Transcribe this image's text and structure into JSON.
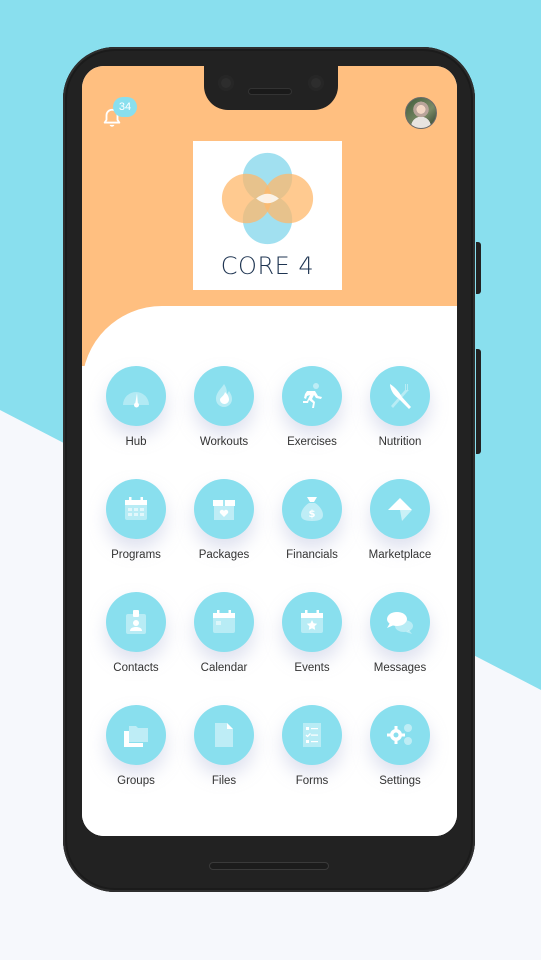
{
  "colors": {
    "background_blue": "#89dfee",
    "background_light": "#f6f8fc",
    "header_orange": "#ffbf80",
    "icon_circle": "#89dfee",
    "phone_body": "#222222",
    "logo_text": "#1f3552"
  },
  "header": {
    "notification_icon": "bell-icon",
    "notification_count": "34",
    "avatar_icon": "user-avatar"
  },
  "logo": {
    "text": "CORE 4"
  },
  "menu": [
    {
      "label": "Hub",
      "icon": "speedometer-icon"
    },
    {
      "label": "Workouts",
      "icon": "flame-icon"
    },
    {
      "label": "Exercises",
      "icon": "running-person-icon"
    },
    {
      "label": "Nutrition",
      "icon": "fork-knife-icon"
    },
    {
      "label": "Programs",
      "icon": "calendar-grid-icon"
    },
    {
      "label": "Packages",
      "icon": "gift-box-heart-icon"
    },
    {
      "label": "Financials",
      "icon": "money-bag-icon"
    },
    {
      "label": "Marketplace",
      "icon": "marketplace-arrow-icon"
    },
    {
      "label": "Contacts",
      "icon": "id-badge-icon"
    },
    {
      "label": "Calendar",
      "icon": "calendar-icon"
    },
    {
      "label": "Events",
      "icon": "calendar-star-icon"
    },
    {
      "label": "Messages",
      "icon": "chat-bubbles-icon"
    },
    {
      "label": "Groups",
      "icon": "folders-icon"
    },
    {
      "label": "Files",
      "icon": "file-icon"
    },
    {
      "label": "Forms",
      "icon": "checklist-icon"
    },
    {
      "label": "Settings",
      "icon": "gears-icon"
    }
  ]
}
